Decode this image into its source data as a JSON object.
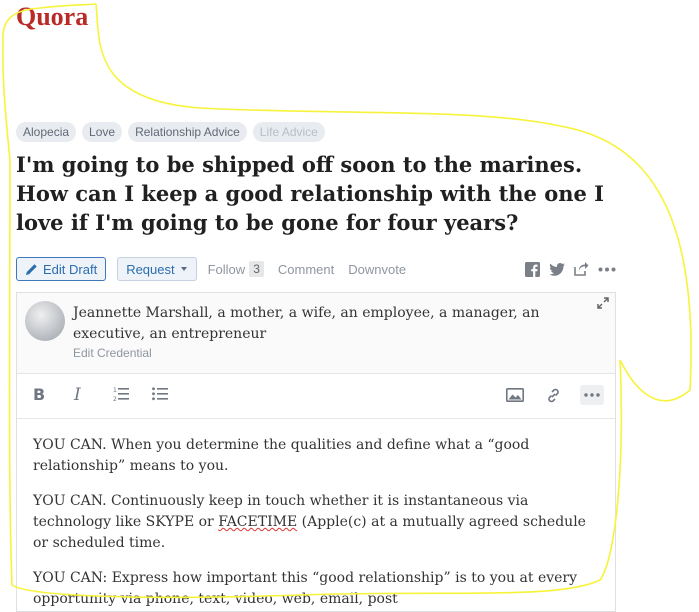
{
  "header": {
    "logo": "Quora"
  },
  "topics": [
    "Alopecia",
    "Love",
    "Relationship Advice",
    "Life Advice"
  ],
  "question": {
    "title": "I'm going to be shipped off soon to the marines. How can I keep a good relationship with the one I love if I'm going to be gone for four years?"
  },
  "actions": {
    "edit_draft": "Edit Draft",
    "request": "Request",
    "follow": "Follow",
    "follow_count": "3",
    "comment": "Comment",
    "downvote": "Downvote"
  },
  "author": {
    "name": "Jeannette Marshall, a mother, a wife, an employee, a manager, an executive, an entrepreneur",
    "credential": "Edit Credential"
  },
  "answer": {
    "p1": "YOU CAN.  When you determine the qualities and define what a “good relationship” means to you.",
    "p2_before": "YOU CAN.  Continuously keep in touch whether it is instantaneous via technology like SKYPE or ",
    "p2_misspelled": "FACETIME",
    "p2_after": " (Apple(c) at a mutually agreed schedule or scheduled time.",
    "p3": "YOU CAN:  Express how important this “good relationship” is to you at every opportunity via phone, text, video, web, email, post"
  },
  "colors": {
    "brand": "#b92b27",
    "link": "#2b6dad",
    "annotation": "#f7f33a"
  }
}
